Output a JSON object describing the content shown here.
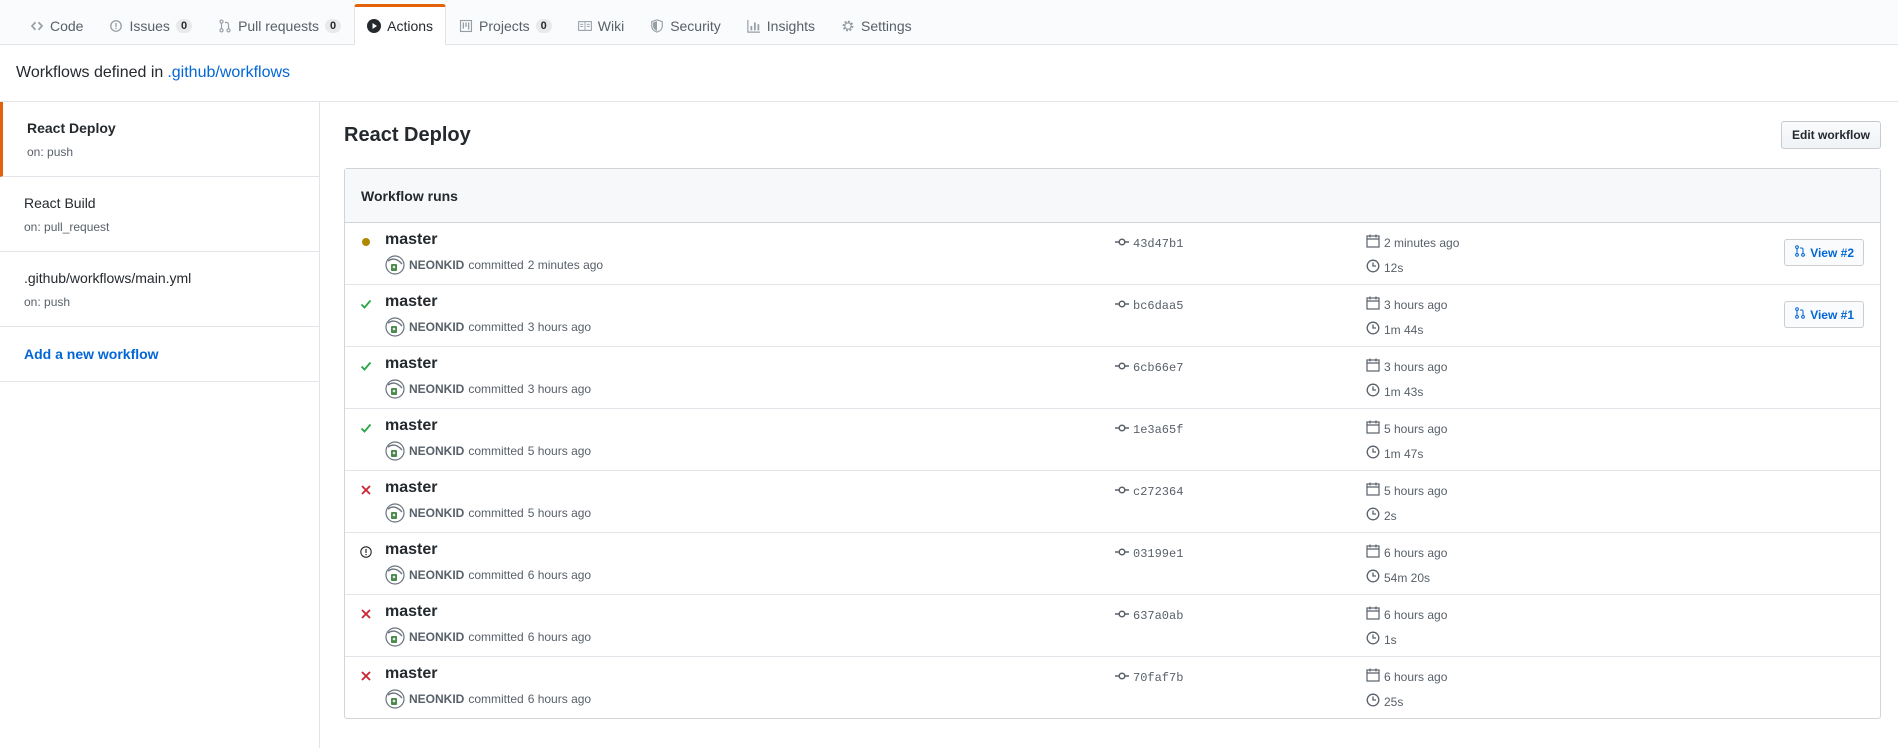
{
  "tabs": [
    {
      "label": "Code",
      "icon": "code-icon"
    },
    {
      "label": "Issues",
      "icon": "issue-icon",
      "count": "0"
    },
    {
      "label": "Pull requests",
      "icon": "pull-request-icon",
      "count": "0"
    },
    {
      "label": "Actions",
      "icon": "play-icon",
      "selected": true
    },
    {
      "label": "Projects",
      "icon": "project-icon",
      "count": "0"
    },
    {
      "label": "Wiki",
      "icon": "book-icon"
    },
    {
      "label": "Security",
      "icon": "shield-icon"
    },
    {
      "label": "Insights",
      "icon": "graph-icon"
    },
    {
      "label": "Settings",
      "icon": "gear-icon"
    }
  ],
  "subheader": {
    "prefix": "Workflows defined in",
    "link": ".github/workflows"
  },
  "sidebar": {
    "items": [
      {
        "name": "React Deploy",
        "trigger": "on: push"
      },
      {
        "name": "React Build",
        "trigger": "on: pull_request"
      },
      {
        "name": ".github/workflows/main.yml",
        "trigger": "on: push"
      }
    ],
    "add_label": "Add a new workflow"
  },
  "main": {
    "title": "React Deploy",
    "edit_label": "Edit workflow",
    "box_title": "Workflow runs",
    "committed_text": "committed",
    "runs": [
      {
        "status": "in_progress",
        "branch": "master",
        "author": "NEONKID",
        "ago": "2 minutes ago",
        "sha": "43d47b1",
        "when": "2 minutes ago",
        "duration": "12s",
        "view": "View #2"
      },
      {
        "status": "success",
        "branch": "master",
        "author": "NEONKID",
        "ago": "3 hours ago",
        "sha": "bc6daa5",
        "when": "3 hours ago",
        "duration": "1m 44s",
        "view": "View #1"
      },
      {
        "status": "success",
        "branch": "master",
        "author": "NEONKID",
        "ago": "3 hours ago",
        "sha": "6cb66e7",
        "when": "3 hours ago",
        "duration": "1m 43s"
      },
      {
        "status": "success",
        "branch": "master",
        "author": "NEONKID",
        "ago": "5 hours ago",
        "sha": "1e3a65f",
        "when": "5 hours ago",
        "duration": "1m 47s"
      },
      {
        "status": "failure",
        "branch": "master",
        "author": "NEONKID",
        "ago": "5 hours ago",
        "sha": "c272364",
        "when": "5 hours ago",
        "duration": "2s"
      },
      {
        "status": "cancelled",
        "branch": "master",
        "author": "NEONKID",
        "ago": "6 hours ago",
        "sha": "03199e1",
        "when": "6 hours ago",
        "duration": "54m 20s"
      },
      {
        "status": "failure",
        "branch": "master",
        "author": "NEONKID",
        "ago": "6 hours ago",
        "sha": "637a0ab",
        "when": "6 hours ago",
        "duration": "1s"
      },
      {
        "status": "failure",
        "branch": "master",
        "author": "NEONKID",
        "ago": "6 hours ago",
        "sha": "70faf7b",
        "when": "6 hours ago",
        "duration": "25s"
      }
    ]
  },
  "colors": {
    "accent": "#e36209",
    "link": "#0366d6",
    "success": "#28a745",
    "failure": "#cb2431",
    "in_progress": "#b08800",
    "muted": "#586069"
  }
}
